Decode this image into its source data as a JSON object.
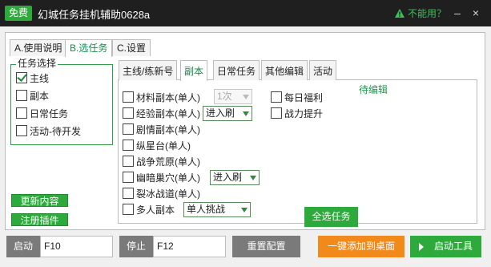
{
  "titlebar": {
    "badge": "免费",
    "title": "幻城任务挂机辅助0628a",
    "help_text": "不能用？",
    "minimize": "–",
    "close": "×"
  },
  "main_tabs": [
    "A.使用说明",
    "B.选任务",
    "C.设置"
  ],
  "task_group": {
    "legend": "任务选择",
    "options": [
      {
        "label": "主线",
        "checked": true
      },
      {
        "label": "副本",
        "checked": false
      },
      {
        "label": "日常任务",
        "checked": false
      },
      {
        "label": "活动-待开发",
        "checked": false
      }
    ]
  },
  "side_buttons": {
    "update": "更新内容",
    "register": "注册插件"
  },
  "sub_tabs": [
    "主线/练新号",
    "副本",
    "日常任务",
    "其他编辑",
    "活动"
  ],
  "dungeon": {
    "left": [
      {
        "label": "材料副本(单人)"
      },
      {
        "label": "经验副本(单人)"
      },
      {
        "label": "剧情副本(单人)"
      },
      {
        "label": "纵星台(单人)"
      },
      {
        "label": "战争荒原(单人)"
      },
      {
        "label": "幽暗巢穴(单人)"
      },
      {
        "label": "裂冰战道(单人)"
      },
      {
        "label": "多人副本"
      }
    ],
    "right": [
      {
        "label": "每日福利"
      },
      {
        "label": "战力提升"
      }
    ],
    "selects": {
      "material": "1次",
      "exp": "进入刷",
      "lair": "进入刷",
      "multi": "单人挑战"
    },
    "pending": "待编辑",
    "select_all": "全选任务"
  },
  "bottom": {
    "start_label": "启动",
    "start_key": "F10",
    "stop_label": "停止",
    "stop_key": "F12",
    "reset": "重置配置",
    "quick_add": "一键添加到桌面",
    "launch": "启动工具"
  },
  "colors": {
    "accent": "#2eaa3c",
    "orange": "#f28a1b",
    "titlebar": "#1f1f1f"
  }
}
